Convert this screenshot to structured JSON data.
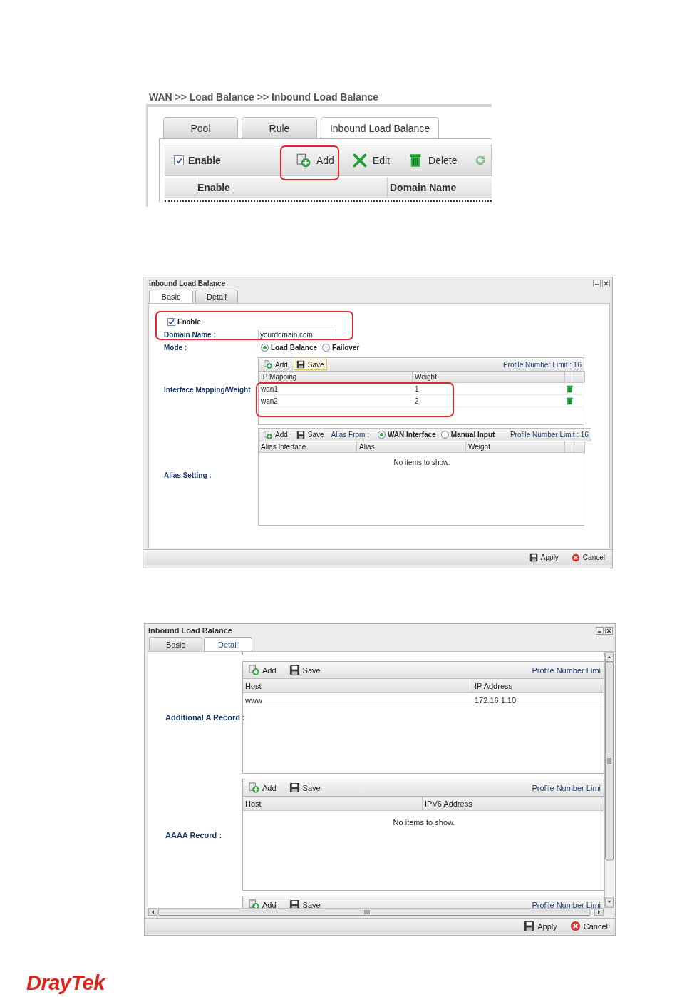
{
  "list_screen": {
    "breadcrumb": "WAN >> Load Balance >> Inbound Load Balance",
    "tabs": [
      {
        "label": "Pool",
        "selected": false
      },
      {
        "label": "Rule",
        "selected": false
      },
      {
        "label": "Inbound Load Balance",
        "selected": true
      }
    ],
    "enable": {
      "label": "Enable",
      "checked": true
    },
    "buttons": [
      {
        "kind": "add",
        "label": "Add",
        "highlighted": true
      },
      {
        "kind": "edit",
        "label": "Edit",
        "highlighted": false
      },
      {
        "kind": "delete",
        "label": "Delete",
        "highlighted": false
      },
      {
        "kind": "refresh",
        "highlighted": false
      }
    ],
    "columns": [
      "Enable",
      "Domain Name"
    ]
  },
  "basic_dialog": {
    "title": "Inbound Load Balance",
    "tabs": [
      {
        "label": "Basic",
        "selected": true
      },
      {
        "label": "Detail",
        "selected": false
      }
    ],
    "identity": {
      "highlighted": true,
      "enable": {
        "label": "Enable",
        "checked": true
      },
      "domain_name": {
        "label": "Domain Name :",
        "value": "yourdomain.com"
      }
    },
    "mode": {
      "label": "Mode :",
      "options": [
        {
          "label": "Load Balance",
          "selected": true
        },
        {
          "label": "Failover",
          "selected": false
        }
      ]
    },
    "interface_mapping": {
      "label": "Interface Mapping/Weight",
      "buttons": [
        {
          "kind": "add",
          "label": "Add",
          "focused": false
        },
        {
          "kind": "save",
          "label": "Save",
          "focused": true
        }
      ],
      "limit": "Profile Number Limit : 16",
      "columns": [
        "IP Mapping",
        "Weight"
      ],
      "rows_highlighted": true,
      "rows": [
        [
          "wan1",
          "1"
        ],
        [
          "wan2",
          "2"
        ]
      ]
    },
    "alias_setting": {
      "label": "Alias Setting :",
      "buttons": [
        {
          "kind": "add",
          "label": "Add",
          "focused": false
        },
        {
          "kind": "save",
          "label": "Save",
          "focused": false
        }
      ],
      "alias_from": {
        "label": "Alias From :",
        "options": [
          {
            "label": "WAN Interface",
            "selected": true
          },
          {
            "label": "Manual Input",
            "selected": false
          }
        ]
      },
      "limit": "Profile Number Limit : 16",
      "columns": [
        "Alias Interface",
        "Alias",
        "Weight"
      ],
      "empty": "No items to show."
    },
    "footer": [
      {
        "kind": "apply",
        "label": "Apply"
      },
      {
        "kind": "cancel",
        "label": "Cancel"
      }
    ]
  },
  "detail_dialog": {
    "title": "Inbound Load Balance",
    "tabs": [
      {
        "label": "Basic",
        "selected": false
      },
      {
        "label": "Detail",
        "selected": true
      }
    ],
    "sections": [
      {
        "label": "Additional A Record :",
        "buttons": [
          {
            "kind": "add",
            "label": "Add"
          },
          {
            "kind": "save",
            "label": "Save"
          }
        ],
        "limit": "Profile Number Limi",
        "columns": [
          "Host",
          "IP Address"
        ],
        "rows": [
          [
            "www",
            "172.16.1.10"
          ]
        ]
      },
      {
        "label": "AAAA Record :",
        "buttons": [
          {
            "kind": "add",
            "label": "Add"
          },
          {
            "kind": "save",
            "label": "Save"
          }
        ],
        "limit": "Profile Number Limi",
        "columns": [
          "Host",
          "IPV6 Address"
        ],
        "empty": "No items to show."
      },
      {
        "buttons": [
          {
            "kind": "add",
            "label": "Add"
          },
          {
            "kind": "save",
            "label": "Save"
          }
        ],
        "limit": "Profile Number Limi"
      }
    ],
    "footer": [
      {
        "kind": "apply",
        "label": "Apply"
      },
      {
        "kind": "cancel",
        "label": "Cancel"
      }
    ]
  },
  "logo": "DrayTek"
}
